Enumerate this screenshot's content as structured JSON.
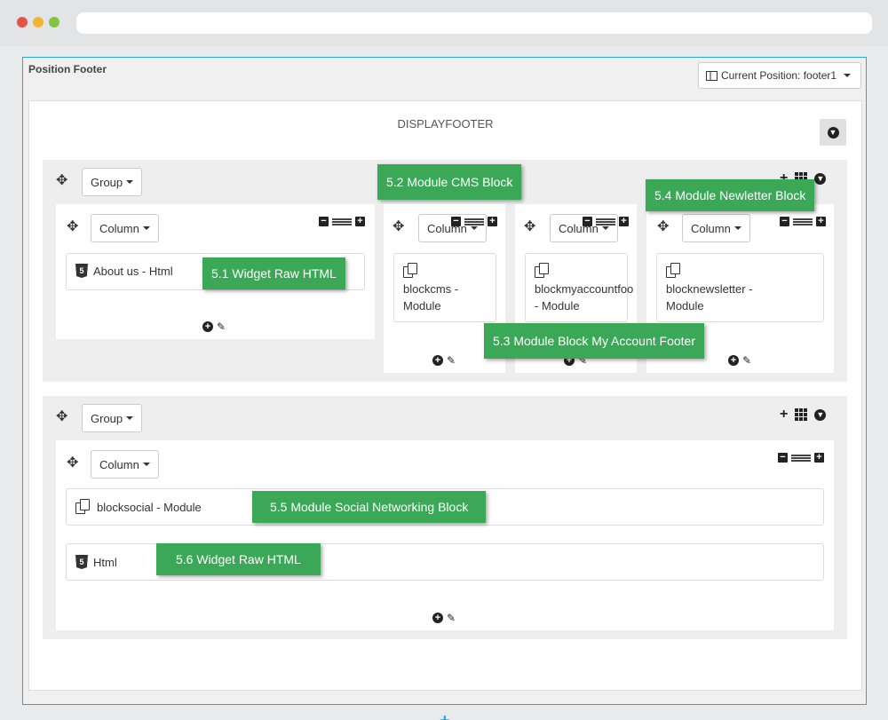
{
  "panel": {
    "title": "Position Footer",
    "current_position_label": "Current Position: footer1"
  },
  "hook": {
    "name": "DISPLAYFOOTER"
  },
  "labels": {
    "group": "Group",
    "column": "Column",
    "html5_glyph": "5",
    "add_glyph": "+"
  },
  "groups": [
    {
      "columns": [
        {
          "widgets": [
            {
              "icon": "html5-icon",
              "text": "About us - Html"
            }
          ]
        },
        {
          "widgets": [
            {
              "icon": "module-icon",
              "line1": "blockcms -",
              "line2": "Module"
            }
          ]
        },
        {
          "widgets": [
            {
              "icon": "module-icon",
              "line1": "blockmyaccountfoo",
              "line2": "- Module"
            }
          ]
        },
        {
          "widgets": [
            {
              "icon": "module-icon",
              "line1": "blocknewsletter -",
              "line2": "Module"
            }
          ]
        }
      ]
    },
    {
      "columns": [
        {
          "widgets": [
            {
              "icon": "module-icon",
              "text": "blocksocial - Module"
            },
            {
              "icon": "html5-icon",
              "text": "Html"
            }
          ]
        }
      ]
    }
  ],
  "callouts": [
    "5.1 Widget Raw HTML",
    "5.2 Module CMS Block",
    "5.3 Module Block My Account Footer",
    "5.4 Module Newletter Block",
    "5.5 Module Social Networking Block",
    "5.6 Widget Raw HTML"
  ],
  "colors": {
    "accent": "#29a8d8",
    "callout": "#3aa857"
  },
  "icons": [
    "move-icon",
    "plus-icon",
    "grid-icon",
    "circle-down-icon",
    "minus-icon",
    "lines-icon",
    "pencil-icon",
    "html5-icon",
    "module-icon",
    "columns-icon"
  ]
}
